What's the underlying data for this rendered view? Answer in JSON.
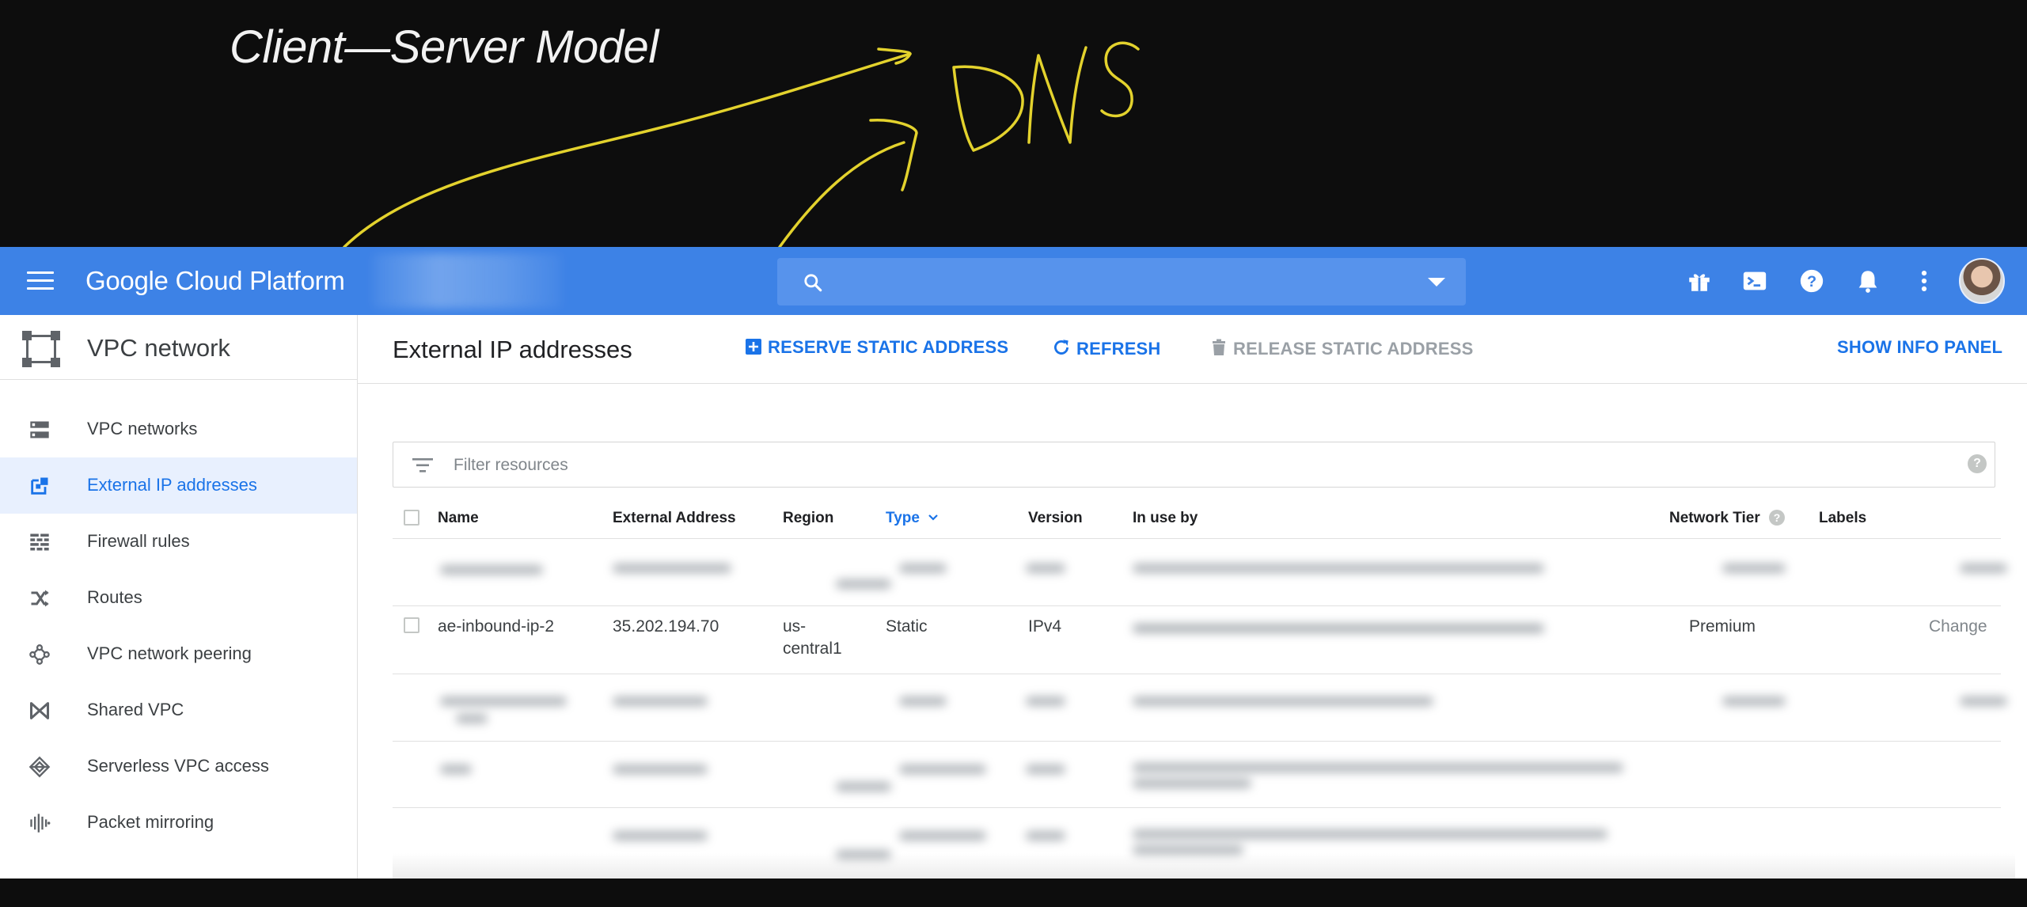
{
  "board": {
    "title": "Client—Server Model",
    "handwritten_note": "DNS",
    "ink_color": "#e3d22d"
  },
  "header": {
    "menu_icon": "hamburger-menu-icon",
    "brand": "Google Cloud Platform",
    "project_selector": "",
    "search_placeholder": "",
    "icons": [
      "gift-icon",
      "terminal-icon",
      "help-icon",
      "bell-icon",
      "more-vert-icon"
    ],
    "accent_color": "#3d82e6"
  },
  "sidebar": {
    "title": "VPC network",
    "items": [
      {
        "label": "VPC networks",
        "icon": "vpc-networks-icon"
      },
      {
        "label": "External IP addresses",
        "icon": "external-ip-icon",
        "active": true
      },
      {
        "label": "Firewall rules",
        "icon": "firewall-icon"
      },
      {
        "label": "Routes",
        "icon": "routes-icon"
      },
      {
        "label": "VPC network peering",
        "icon": "peering-icon"
      },
      {
        "label": "Shared VPC",
        "icon": "shared-vpc-icon"
      },
      {
        "label": "Serverless VPC access",
        "icon": "serverless-icon"
      },
      {
        "label": "Packet mirroring",
        "icon": "packet-mirroring-icon"
      }
    ]
  },
  "toolbar": {
    "page_title": "External IP addresses",
    "reserve_label": "RESERVE STATIC ADDRESS",
    "refresh_label": "REFRESH",
    "release_label": "RELEASE STATIC ADDRESS",
    "info_panel_label": "SHOW INFO PANEL"
  },
  "filter": {
    "placeholder": "Filter resources"
  },
  "table": {
    "columns": [
      "Name",
      "External Address",
      "Region",
      "Type",
      "Version",
      "In use by",
      "Network Tier",
      "Labels"
    ],
    "sorted_column": "Type",
    "rows": [
      {
        "name": "ae-inbound-ip-2",
        "external_address": "35.202.194.70",
        "region_line1": "us-",
        "region_line2": "central1",
        "type": "Static",
        "version": "IPv4",
        "in_use_by": "",
        "network_tier": "Premium",
        "labels_action": "Change"
      }
    ]
  }
}
